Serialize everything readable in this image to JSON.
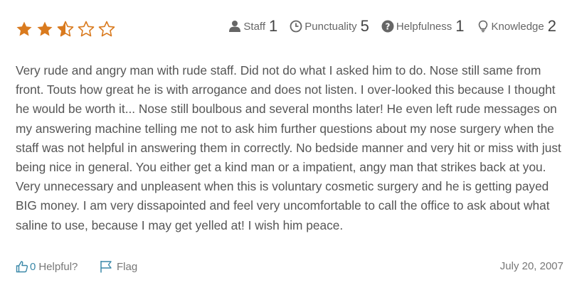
{
  "rating": {
    "stars_value": 2.5,
    "stars_max": 5,
    "star_color": "#d97a1e"
  },
  "scores": [
    {
      "label": "Staff",
      "value": "1",
      "icon": "person-icon"
    },
    {
      "label": "Punctuality",
      "value": "5",
      "icon": "clock-icon"
    },
    {
      "label": "Helpfulness",
      "value": "1",
      "icon": "question-circle-icon"
    },
    {
      "label": "Knowledge",
      "value": "2",
      "icon": "lightbulb-icon"
    }
  ],
  "review": {
    "text": "Very rude and angry man with rude staff. Did not do what I asked him to do. Nose still same from front. Touts how great he is with arrogance and does not listen. I over-looked this because I thought he would be worth it... Nose still boulbous and several months later! He even left rude messages on my answering machine telling me not to ask him further questions about my nose surgery when the staff was not helpful in answering them in correctly. No bedside manner and very hit or miss with just being nice in general. You either get a kind man or a impatient, angy man that strikes back at you. Very unnecessary and unpleasent when this is voluntary cosmetic surgery and he is getting payed BIG money. I am very dissapointed and feel very uncomfortable to call the office to ask about what saline to use, because I may get yelled at! I wish him peace."
  },
  "footer": {
    "helpful_count": "0",
    "helpful_label": "Helpful?",
    "flag_label": "Flag",
    "date": "July 20, 2007",
    "link_color": "#3a88a8"
  }
}
